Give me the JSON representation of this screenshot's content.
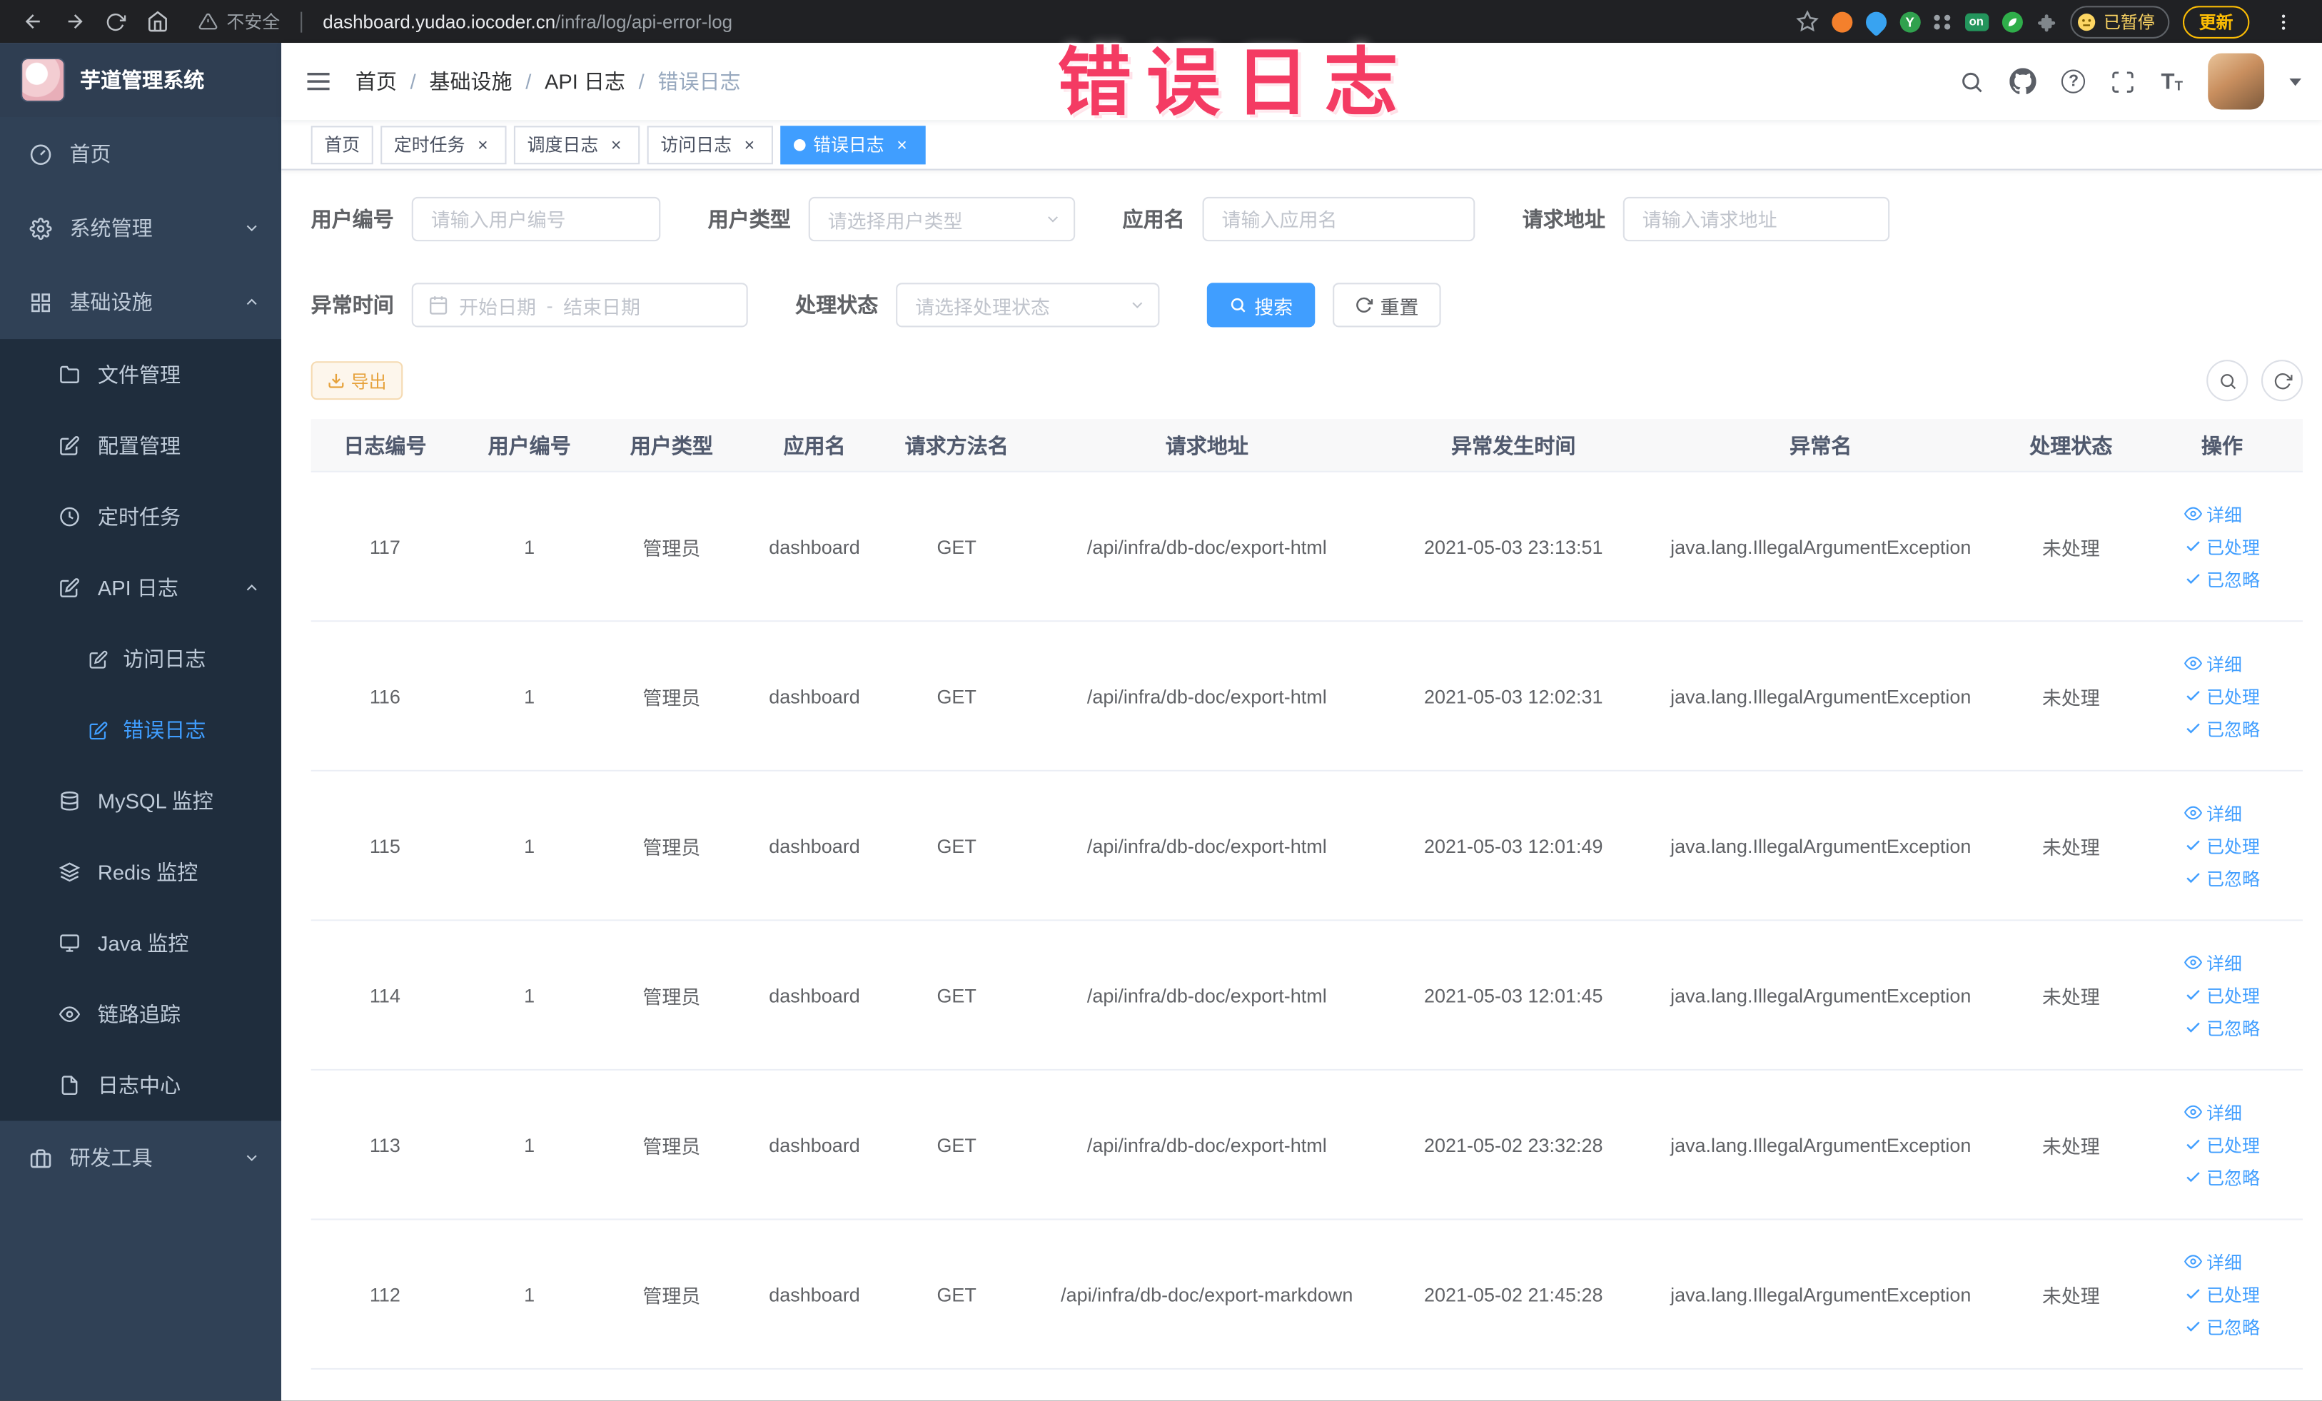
{
  "colors": {
    "accent": "#409eff",
    "warning": "#e6a23c",
    "sidebar_bg": "#304156",
    "submenu_bg": "#1f2d3d",
    "active_tab_bg": "#409eff",
    "annotation": "#f43b63",
    "chrome_bg": "#202124"
  },
  "browser": {
    "security_label": "不安全",
    "url_host": "dashboard.yudao.iocoder.cn",
    "url_path": "/infra/log/api-error-log",
    "extension_letter": "Y",
    "extension_on_badge": "on",
    "paused_badge": "已暂停",
    "update_button": "更新"
  },
  "annotation": {
    "text": "错误日志"
  },
  "sidebar": {
    "logo_title": "芋道管理系统",
    "home": "首页",
    "system_mgmt": "系统管理",
    "infrastructure": "基础设施",
    "file_mgmt": "文件管理",
    "config_mgmt": "配置管理",
    "scheduled_tasks": "定时任务",
    "api_log": "API 日志",
    "access_log": "访问日志",
    "error_log": "错误日志",
    "mysql_monitor": "MySQL 监控",
    "redis_monitor": "Redis 监控",
    "java_monitor": "Java 监控",
    "trace": "链路追踪",
    "log_center": "日志中心",
    "dev_tools": "研发工具"
  },
  "header": {
    "breadcrumb": [
      "首页",
      "基础设施",
      "API 日志",
      "错误日志"
    ],
    "breadcrumb_separator": "/"
  },
  "tabs": [
    {
      "label": "首页",
      "closable": false,
      "active": false
    },
    {
      "label": "定时任务",
      "closable": true,
      "active": false
    },
    {
      "label": "调度日志",
      "closable": true,
      "active": false
    },
    {
      "label": "访问日志",
      "closable": true,
      "active": false
    },
    {
      "label": "错误日志",
      "closable": true,
      "active": true
    }
  ],
  "filters": {
    "user_id_label": "用户编号",
    "user_id_placeholder": "请输入用户编号",
    "user_type_label": "用户类型",
    "user_type_placeholder": "请选择用户类型",
    "app_name_label": "应用名",
    "app_name_placeholder": "请输入应用名",
    "request_url_label": "请求地址",
    "request_url_placeholder": "请输入请求地址",
    "exception_time_label": "异常时间",
    "start_date_placeholder": "开始日期",
    "range_separator": "-",
    "end_date_placeholder": "结束日期",
    "process_status_label": "处理状态",
    "process_status_placeholder": "请选择处理状态",
    "search_button": "搜索",
    "reset_button": "重置"
  },
  "toolbar": {
    "export_button": "导出"
  },
  "table": {
    "columns": [
      "日志编号",
      "用户编号",
      "用户类型",
      "应用名",
      "请求方法名",
      "请求地址",
      "异常发生时间",
      "异常名",
      "处理状态",
      "操作"
    ],
    "actions": {
      "detail": "详细",
      "processed": "已处理",
      "ignored": "已忽略"
    },
    "rows": [
      {
        "id": "117",
        "user_id": "1",
        "user_type": "管理员",
        "app": "dashboard",
        "method": "GET",
        "url": "/api/infra/db-doc/export-html",
        "time": "2021-05-03 23:13:51",
        "exception": "java.lang.IllegalArgumentException",
        "status": "未处理"
      },
      {
        "id": "116",
        "user_id": "1",
        "user_type": "管理员",
        "app": "dashboard",
        "method": "GET",
        "url": "/api/infra/db-doc/export-html",
        "time": "2021-05-03 12:02:31",
        "exception": "java.lang.IllegalArgumentException",
        "status": "未处理"
      },
      {
        "id": "115",
        "user_id": "1",
        "user_type": "管理员",
        "app": "dashboard",
        "method": "GET",
        "url": "/api/infra/db-doc/export-html",
        "time": "2021-05-03 12:01:49",
        "exception": "java.lang.IllegalArgumentException",
        "status": "未处理"
      },
      {
        "id": "114",
        "user_id": "1",
        "user_type": "管理员",
        "app": "dashboard",
        "method": "GET",
        "url": "/api/infra/db-doc/export-html",
        "time": "2021-05-03 12:01:45",
        "exception": "java.lang.IllegalArgumentException",
        "status": "未处理"
      },
      {
        "id": "113",
        "user_id": "1",
        "user_type": "管理员",
        "app": "dashboard",
        "method": "GET",
        "url": "/api/infra/db-doc/export-html",
        "time": "2021-05-02 23:32:28",
        "exception": "java.lang.IllegalArgumentException",
        "status": "未处理"
      },
      {
        "id": "112",
        "user_id": "1",
        "user_type": "管理员",
        "app": "dashboard",
        "method": "GET",
        "url": "/api/infra/db-doc/export-markdown",
        "time": "2021-05-02 21:45:28",
        "exception": "java.lang.IllegalArgumentException",
        "status": "未处理"
      }
    ]
  },
  "icons": {
    "close": "×",
    "question": "?",
    "font_size": "T"
  }
}
